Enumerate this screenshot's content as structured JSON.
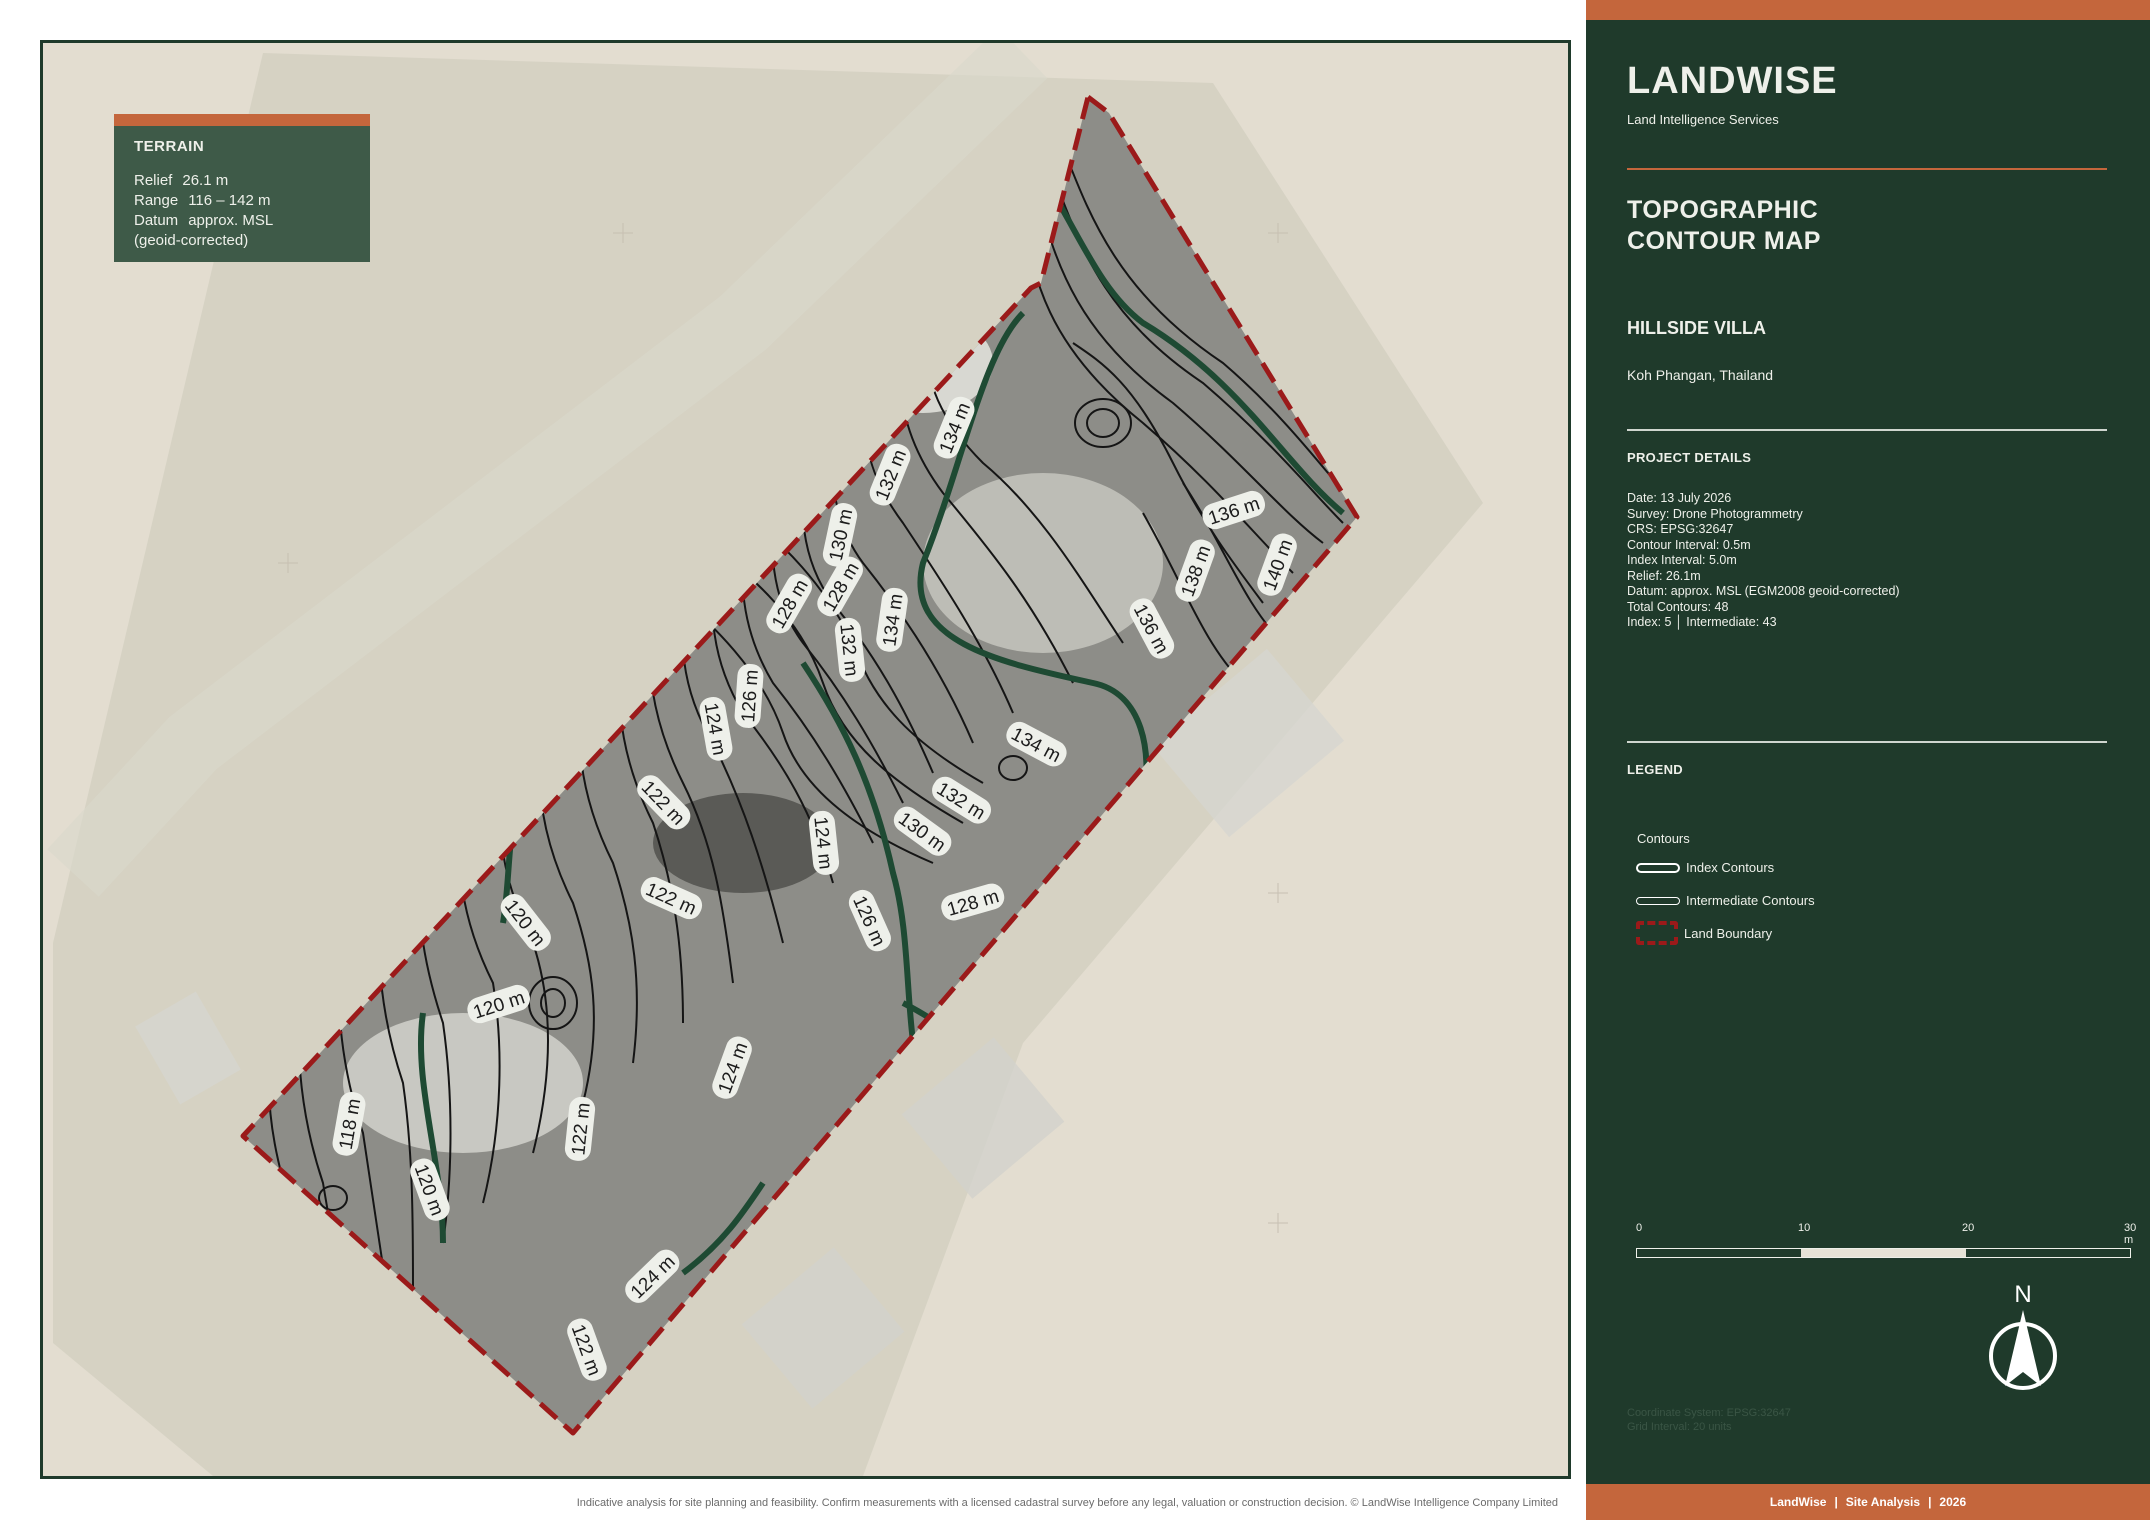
{
  "terrain": {
    "title": "TERRAIN",
    "relief_label": "Relief",
    "relief_value": "26.1 m",
    "range_label": "Range",
    "range_value": "116 – 142 m",
    "datum_label": "Datum",
    "datum_value": "approx. MSL",
    "datum_note": "(geoid-corrected)"
  },
  "contour_labels": [
    "134 m",
    "132 m",
    "130 m",
    "128 m",
    "134 m",
    "132 m",
    "126 m",
    "124 m",
    "136 m",
    "138 m",
    "140 m",
    "136 m",
    "134 m",
    "132 m",
    "130 m",
    "128 m",
    "124 m",
    "122 m",
    "122 m",
    "128 m",
    "126 m",
    "120 m",
    "120 m",
    "124 m",
    "118 m",
    "122 m",
    "120 m",
    "124 m",
    "122 m"
  ],
  "footer_note": "Indicative analysis for site planning and feasibility. Confirm measurements with a licensed cadastral survey before any legal, valuation or construction decision. © LandWise Intelligence Company Limited",
  "sidebar": {
    "brand": "LANDWISE",
    "brand_sub": "Land Intelligence Services",
    "title_line1": "TOPOGRAPHIC",
    "title_line2": "CONTOUR MAP",
    "project_name": "HILLSIDE VILLA",
    "location": "Koh Phangan, Thailand",
    "details_title": "PROJECT DETAILS",
    "details": [
      "Date:  13 July 2026",
      "Survey:  Drone Photogrammetry",
      "CRS:  EPSG:32647",
      "Contour Interval:  0.5m",
      "Index Interval:  5.0m",
      "Relief:  26.1m",
      "Datum:  approx. MSL (EGM2008 geoid-corrected)",
      "Total Contours:  48",
      "Index: 5  │  Intermediate: 43"
    ],
    "legend_title": "LEGEND",
    "legend_sub": "Contours",
    "legend_index": "Index Contours",
    "legend_intermediate": "Intermediate Contours",
    "legend_boundary": "Land Boundary",
    "scale_0": "0",
    "scale_10": "10",
    "scale_20": "20",
    "scale_30": "30 m",
    "north": "N",
    "coord_line1": "Coordinate System: EPSG:32647",
    "coord_line2": "Grid Interval: 20 units",
    "footer_brand": "LandWise",
    "footer_sep": "|",
    "footer_type": "Site Analysis",
    "footer_year": "2026"
  },
  "colors": {
    "panel": "#1f3a2b",
    "accent": "#c4663c",
    "boundary": "#9b1a1a",
    "index_contour": "#1e4a33"
  }
}
